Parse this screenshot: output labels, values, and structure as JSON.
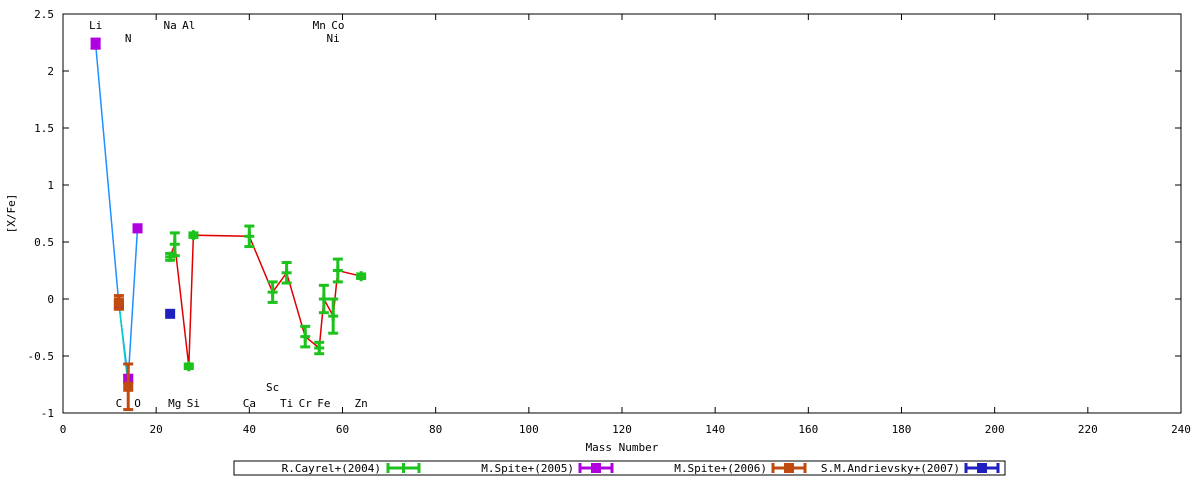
{
  "chart_data": {
    "type": "scatter",
    "xlabel": "Mass Number",
    "ylabel": "[X/Fe]",
    "xlim": [
      0,
      240
    ],
    "ylim": [
      -1,
      2.5
    ],
    "xticks": [
      0,
      20,
      40,
      60,
      80,
      100,
      120,
      140,
      160,
      180,
      200,
      220,
      240
    ],
    "yticks": [
      -1,
      -0.5,
      0,
      0.5,
      1,
      1.5,
      2,
      2.5
    ],
    "ytick_labels": [
      "-1",
      "-0.5",
      "0",
      "0.5",
      "1",
      "1.5",
      "2",
      "2.5"
    ],
    "legend_position": "bottom",
    "element_labels_top": [
      {
        "text": "Li",
        "x": 7,
        "row": 1
      },
      {
        "text": "Na",
        "x": 23,
        "row": 1
      },
      {
        "text": "Al",
        "x": 27,
        "row": 1
      },
      {
        "text": "Mn",
        "x": 55,
        "row": 1
      },
      {
        "text": "Co",
        "x": 59,
        "row": 1
      },
      {
        "text": "N",
        "x": 14,
        "row": 2
      },
      {
        "text": "Ni",
        "x": 58,
        "row": 2
      }
    ],
    "element_labels_bottom": [
      {
        "text": "Sc",
        "x": 45,
        "row": 1
      },
      {
        "text": "C",
        "x": 12,
        "row": 2
      },
      {
        "text": "O",
        "x": 16,
        "row": 2
      },
      {
        "text": "Mg",
        "x": 24,
        "row": 2
      },
      {
        "text": "Si",
        "x": 28,
        "row": 2
      },
      {
        "text": "Ca",
        "x": 40,
        "row": 2
      },
      {
        "text": "Ti",
        "x": 48,
        "row": 2
      },
      {
        "text": "Cr",
        "x": 52,
        "row": 2
      },
      {
        "text": "Fe",
        "x": 56,
        "row": 2
      },
      {
        "text": "Zn",
        "x": 64,
        "row": 2
      }
    ],
    "series": [
      {
        "name": "R.Cayrel+(2004)",
        "color": "#1dc21d",
        "marker": "plus",
        "line_color": "#e00000",
        "points": [
          {
            "x": 23,
            "y": 0.37,
            "err": 0.03
          },
          {
            "x": 24,
            "y": 0.48,
            "err": 0.1
          },
          {
            "x": 27,
            "y": -0.59,
            "err": 0.02
          },
          {
            "x": 28,
            "y": 0.56,
            "err": 0.02
          },
          {
            "x": 40,
            "y": 0.55,
            "err": 0.09
          },
          {
            "x": 45,
            "y": 0.06,
            "err": 0.09
          },
          {
            "x": 48,
            "y": 0.23,
            "err": 0.09
          },
          {
            "x": 52,
            "y": -0.33,
            "err": 0.09
          },
          {
            "x": 55,
            "y": -0.43,
            "err": 0.05
          },
          {
            "x": 56,
            "y": 0.0,
            "err": 0.12
          },
          {
            "x": 58,
            "y": -0.15,
            "err": 0.15
          },
          {
            "x": 59,
            "y": 0.25,
            "err": 0.1
          },
          {
            "x": 64,
            "y": 0.2,
            "err": 0.02
          }
        ]
      },
      {
        "name": "M.Spite+(2005)",
        "color": "#b000e0",
        "marker": "square",
        "line_color": "#1e90ff",
        "points": [
          {
            "x": 7,
            "y": 2.24,
            "err": 0.04
          },
          {
            "x": 12,
            "y": -0.05,
            "err": 0.03
          },
          {
            "x": 14,
            "y": -0.7,
            "err": 0.03
          },
          {
            "x": 16,
            "y": 0.62,
            "err": 0.03
          }
        ]
      },
      {
        "name": "M.Spite+(2006)",
        "color": "#c04a10",
        "marker": "square",
        "line_color": "#00cccc",
        "points": [
          {
            "x": 12,
            "y": -0.03,
            "err": 0.06
          },
          {
            "x": 14,
            "y": -0.77,
            "err": 0.2
          }
        ]
      },
      {
        "name": "S.M.Andrievsky+(2007)",
        "color": "#2020c0",
        "marker": "square",
        "points": [
          {
            "x": 23,
            "y": -0.13,
            "err": 0.0
          }
        ]
      }
    ]
  }
}
